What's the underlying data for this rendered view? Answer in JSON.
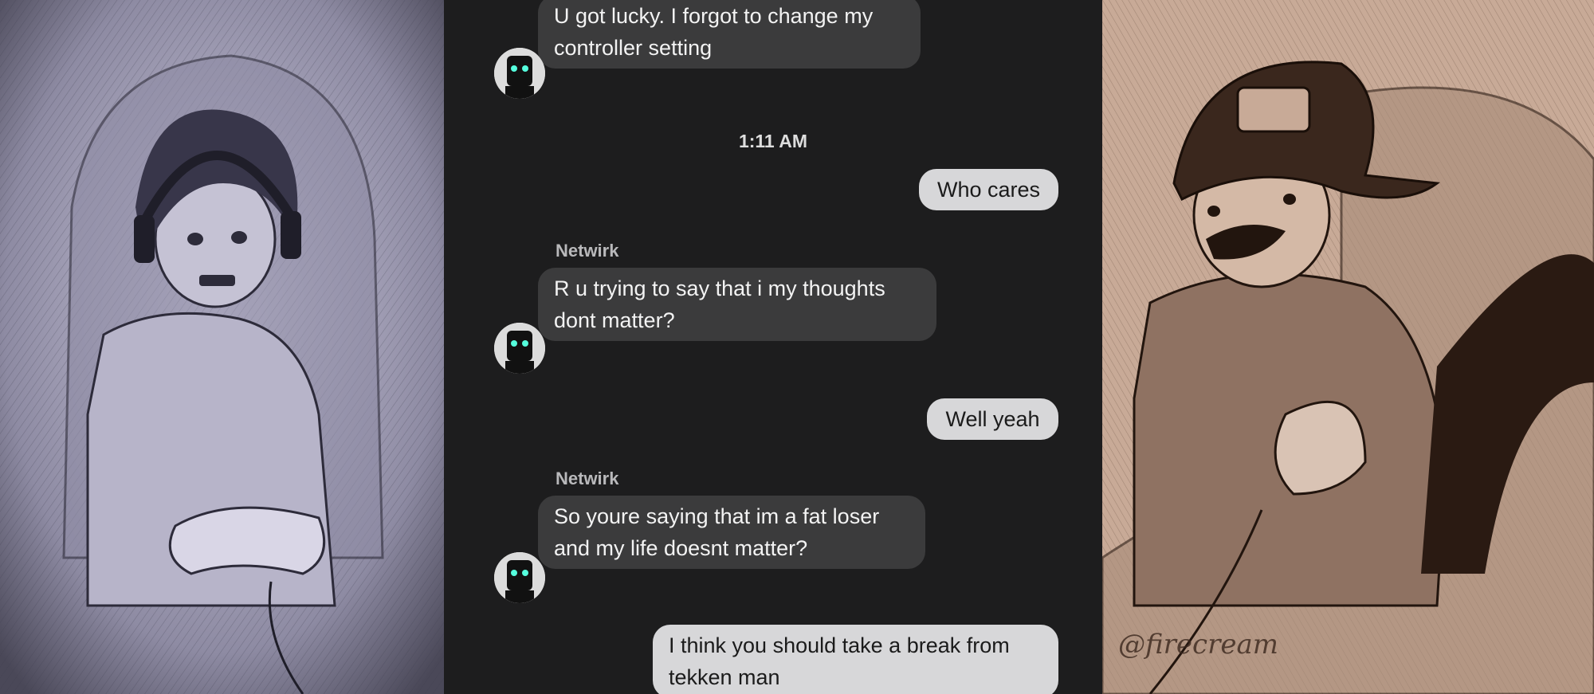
{
  "conversation": {
    "time_separator": "1:11 AM",
    "messages": [
      {
        "direction": "incoming",
        "sender": "",
        "text": "U got lucky. I forgot to change my\ncontroller setting"
      },
      {
        "direction": "outgoing",
        "text": "Who cares"
      },
      {
        "direction": "incoming",
        "sender": "Netwirk",
        "text": "R u trying to say that i my thoughts\ndont matter?"
      },
      {
        "direction": "outgoing",
        "text": "Well yeah"
      },
      {
        "direction": "incoming",
        "sender": "Netwirk",
        "text": "So youre saying that im a fat loser\nand my life doesnt matter?"
      },
      {
        "direction": "outgoing",
        "text": "I think you should take a break from\ntekken man"
      }
    ]
  },
  "avatars": {
    "icon": "robot-avatar-icon"
  },
  "artwork": {
    "left_panel": "pencil-sketch-gamer-headset",
    "right_panel": "pencil-sketch-gamer-cap",
    "signature": "@firecream"
  },
  "colors": {
    "chat_background": "#1d1d1e",
    "incoming_bubble": "#3b3b3c",
    "outgoing_bubble": "#d7d7d9",
    "left_tint": "#a9a6bd",
    "right_tint": "#c8aa97"
  }
}
